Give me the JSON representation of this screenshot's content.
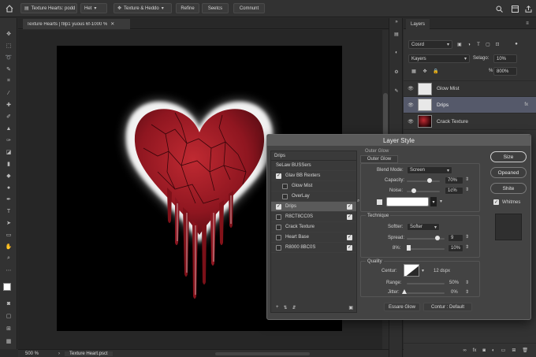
{
  "options_bar": {
    "home_icon": "home-icon",
    "doc_dropdown": "Texture Hearts: podd",
    "fill_dropdown": "Het",
    "texture_dropdown": "Texture & Heddo",
    "refine_label": "Refine",
    "select_label": "Seetcs",
    "comment_label": "Comnunt"
  },
  "document_tab": {
    "title": "Texture Hearts | f8p1 yuous 6f-1000 %",
    "close_icon": "close-icon"
  },
  "status_bar": {
    "zoom": "500 %",
    "doc_name": "Texture Heart.psct"
  },
  "layers_panel": {
    "tab_label": "Layers",
    "filter_dropdown": "Cosrd",
    "blend_mode": "Kayers",
    "opacity_label": "Selago:",
    "opacity_value": "10%",
    "fill_label": "%",
    "fill_value": "800%",
    "layers": [
      {
        "name": "Glow Mist",
        "selected": false
      },
      {
        "name": "Drips",
        "selected": true
      },
      {
        "name": "Crack Texture",
        "selected": false
      }
    ]
  },
  "layer_style": {
    "title": "Layer Style",
    "left_header": "Drips",
    "effects": [
      {
        "label": "SeLaw BUSSers",
        "checkbox": false,
        "has_checkbox": false,
        "right_check": false,
        "indent": false,
        "selected": false
      },
      {
        "label": "Glav BB Rexters",
        "checkbox": true,
        "has_checkbox": true,
        "right_check": false,
        "indent": false,
        "selected": false
      },
      {
        "label": "Glow Mist",
        "checkbox": false,
        "has_checkbox": true,
        "right_check": false,
        "indent": true,
        "selected": false
      },
      {
        "label": "OverLay",
        "checkbox": false,
        "has_checkbox": true,
        "right_check": false,
        "indent": true,
        "selected": false
      },
      {
        "label": "Drips",
        "checkbox": true,
        "has_checkbox": true,
        "right_check": true,
        "indent": false,
        "selected": true
      },
      {
        "label": "R8CT8CC0S",
        "checkbox": false,
        "has_checkbox": true,
        "right_check": true,
        "indent": false,
        "selected": false
      },
      {
        "label": "Crack Texture",
        "checkbox": false,
        "has_checkbox": true,
        "right_check": false,
        "indent": false,
        "selected": false
      },
      {
        "label": "Heart Base",
        "checkbox": false,
        "has_checkbox": true,
        "right_check": true,
        "indent": false,
        "selected": false
      },
      {
        "label": "R8000 8BC0S",
        "checkbox": false,
        "has_checkbox": true,
        "right_check": true,
        "indent": false,
        "selected": false
      }
    ],
    "outer_glow": {
      "section_title": "Outer Glow",
      "tab_label": "Outer Glow",
      "blend_mode_label": "Blend Mode:",
      "blend_mode_value": "Screen",
      "opacity_label": "Capacity:",
      "opacity_value": "70%",
      "opacity_level": 0.7,
      "noise_label": "Noise:",
      "noise_value": "1c%",
      "technique_title": "Technique",
      "softer_label": "Softter:",
      "softer_value": "Softer",
      "spread_label": "Spread:",
      "spread_value": "9",
      "size_label": "8%:",
      "size_value": "10%",
      "quality_title": "Quality",
      "contour_label": "Centur:",
      "contour_value": "12 dspx",
      "range_label": "Range:",
      "range_value": "50%",
      "jitter_label": "Jitter:",
      "jitter_value": "0%",
      "make_default": "Essare Glow",
      "reset_default": "Contur : Default"
    },
    "buttons": {
      "size": "Size",
      "opened": "Opeaned",
      "shite": "Shite",
      "whitmes_label": "Whitmes"
    }
  },
  "colors": {
    "accent_selected_layer": "#55596a",
    "heart_red": "#9a1822",
    "glow": "#ffffff"
  }
}
